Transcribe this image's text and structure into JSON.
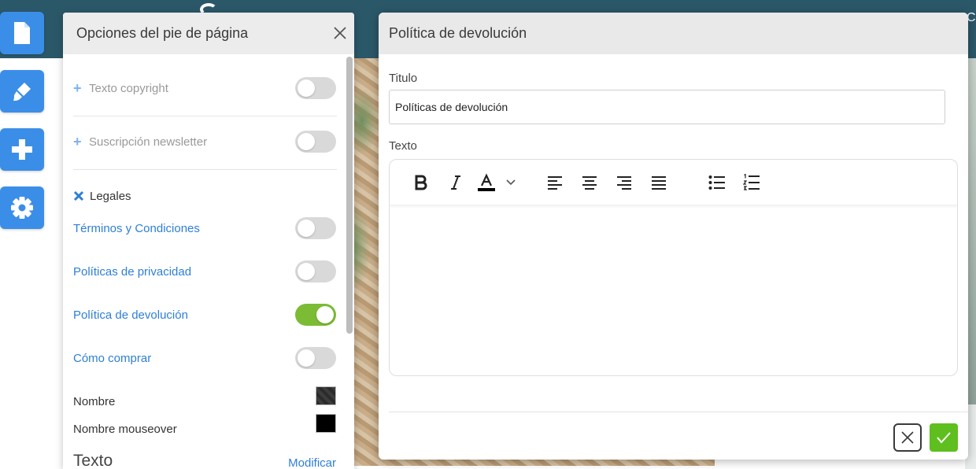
{
  "topbar": {
    "clip_text": "Co"
  },
  "rail": {
    "items": [
      {
        "icon": "page-icon"
      },
      {
        "icon": "brush-icon"
      },
      {
        "icon": "plus-icon"
      },
      {
        "icon": "gear-icon"
      }
    ],
    "color": "#3b8ee8"
  },
  "footer_panel": {
    "title": "Opciones del pie de página",
    "copyright": {
      "label": "Texto copyright",
      "enabled": false
    },
    "newsletter": {
      "label": "Suscripción newsletter",
      "enabled": false
    },
    "legal": {
      "label": "Legales",
      "items": [
        {
          "label": "Términos y Condiciones",
          "enabled": false
        },
        {
          "label": "Políticas de privacidad",
          "enabled": false
        },
        {
          "label": "Política de devolución",
          "enabled": true
        },
        {
          "label": "Cómo comprar",
          "enabled": false
        }
      ]
    },
    "name_label": "Nombre",
    "name_mouseover_label": "Nombre mouseover",
    "text_heading": "Texto",
    "modify_link": "Modificar",
    "colors": {
      "toggle_on": "#7cbc34",
      "link": "#2e7fd6",
      "name_swatch": "#2b2b2b",
      "mouseover_swatch": "#000000"
    }
  },
  "dialog": {
    "title": "Política de devolución",
    "title_field_label": "Titulo",
    "title_field_value": "Políticas de devolución",
    "text_field_label": "Texto",
    "toolbar": [
      "bold-icon",
      "italic-icon",
      "text-color-icon",
      "chevron-down-icon",
      "align-left-icon",
      "align-center-icon",
      "align-right-icon",
      "align-justify-icon",
      "bullet-list-icon",
      "numbered-list-icon"
    ],
    "colors": {
      "confirm": "#5fbf1e"
    }
  }
}
